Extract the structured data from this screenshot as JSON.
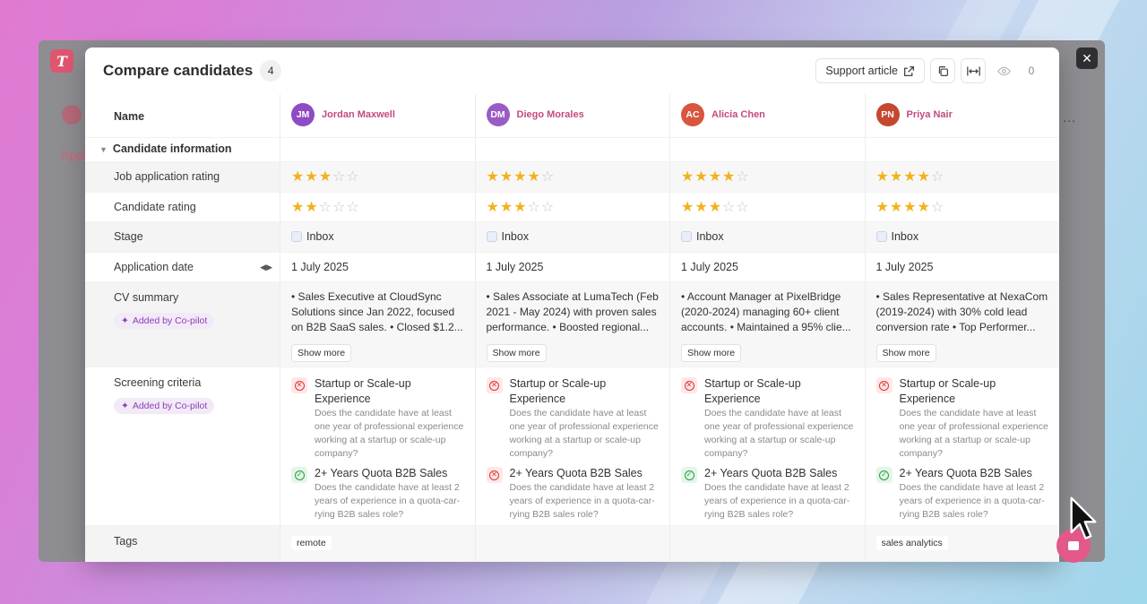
{
  "app": {
    "logo_letter": "T",
    "side_text": "Appl",
    "menu_dots": "..."
  },
  "modal": {
    "title": "Compare candidates",
    "count": "4",
    "support_label": "Support article",
    "viewer_count": "0",
    "close_label": "✕"
  },
  "rows": {
    "name": "Name",
    "section": "Candidate information",
    "job_rating": "Job application rating",
    "candidate_rating": "Candidate rating",
    "stage": "Stage",
    "application_date": "Application date",
    "cv_summary": "CV summary",
    "screening": "Screening criteria",
    "tags": "Tags",
    "copilot_badge": "Added by Co-pilot",
    "show_more": "Show more"
  },
  "criteria": [
    {
      "title": "Startup or Scale-up Experience",
      "desc": "Does the candidate have at least one year of professional experience working at a startup or scale-up company?"
    },
    {
      "title": "2+ Years Quota B2B Sales",
      "desc": "Does the candidate have at least 2 years of experience in a quota-car-rying B2B sales role?"
    }
  ],
  "candidates": [
    {
      "initials": "JM",
      "name": "Jordan Maxwell",
      "avatar_color": "#8e4bc2",
      "job_rating": 3,
      "candidate_rating": 2,
      "stage": "Inbox",
      "date": "1 July 2025",
      "cv": "• Sales Executive at CloudSync Solutions since Jan 2022, focused on B2B SaaS sales. • Closed $1.2...",
      "c1": "fail",
      "c2": "pass",
      "tag": "remote"
    },
    {
      "initials": "DM",
      "name": "Diego Morales",
      "avatar_color": "#9a5cc4",
      "job_rating": 4,
      "candidate_rating": 3,
      "stage": "Inbox",
      "date": "1 July 2025",
      "cv": "• Sales Associate at LumaTech (Feb 2021 - May 2024) with proven sales performance. • Boosted regional...",
      "c1": "fail",
      "c2": "fail",
      "tag": ""
    },
    {
      "initials": "AC",
      "name": "Alicia Chen",
      "avatar_color": "#d9553e",
      "job_rating": 4,
      "candidate_rating": 3,
      "stage": "Inbox",
      "date": "1 July 2025",
      "cv": "• Account Manager at PixelBridge (2020-2024) managing 60+ client accounts. • Maintained a 95% clie...",
      "c1": "fail",
      "c2": "pass",
      "tag": ""
    },
    {
      "initials": "PN",
      "name": "Priya Nair",
      "avatar_color": "#c4482f",
      "job_rating": 4,
      "candidate_rating": 4,
      "stage": "Inbox",
      "date": "1 July 2025",
      "cv": "• Sales Representative at NexaCom (2019-2024) with 30% cold lead conversion rate • Top Performer...",
      "c1": "fail",
      "c2": "pass",
      "tag": "sales analytics"
    }
  ],
  "colors": {
    "accent": "#c44a7e",
    "star": "#f2b21b",
    "fail": "#d33333",
    "pass": "#2a9b45"
  }
}
